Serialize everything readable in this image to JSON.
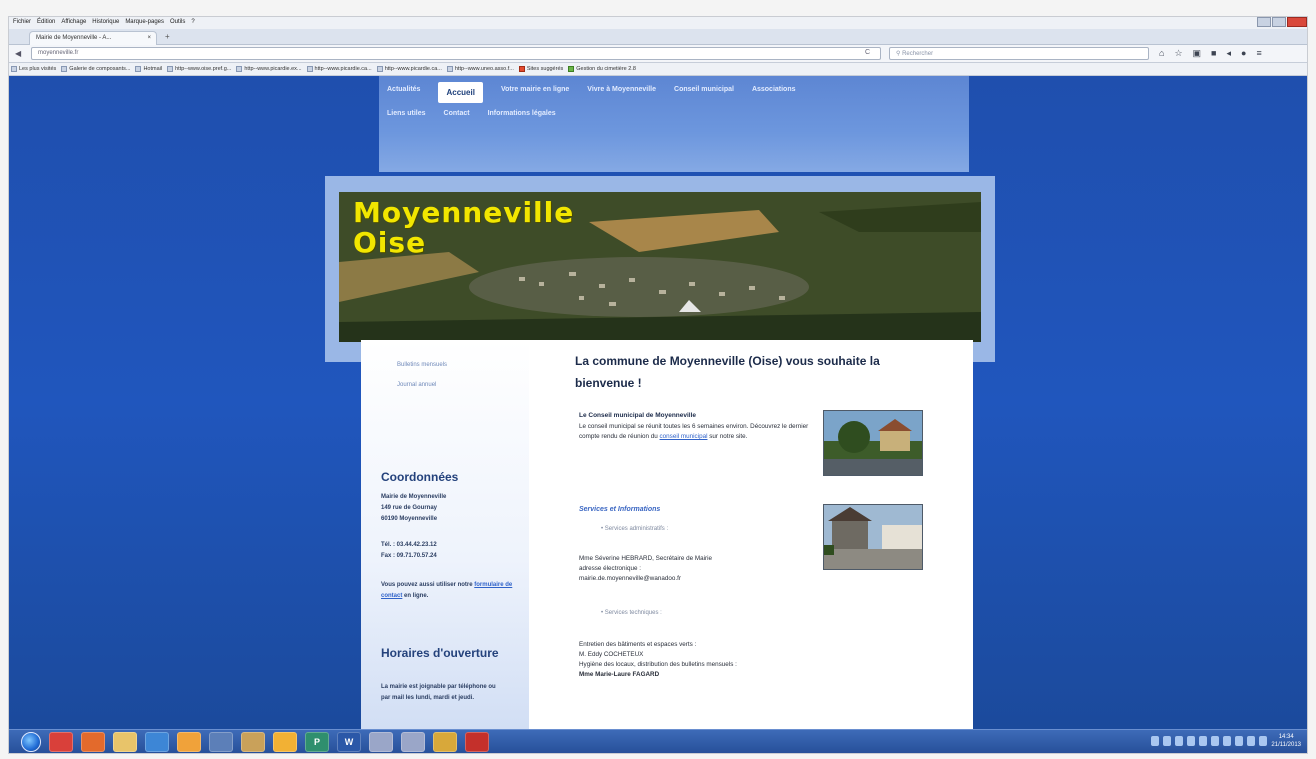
{
  "browser": {
    "menu": [
      "Fichier",
      "Édition",
      "Affichage",
      "Historique",
      "Marque-pages",
      "Outils",
      "?"
    ],
    "tab_title": "Mairie de Moyenneville - A...",
    "tab_close": "×",
    "new_tab": "+",
    "url": "moyenneville.fr",
    "search_placeholder": "Rechercher",
    "bookmarks": [
      {
        "label": "Les plus visités",
        "icon": "page"
      },
      {
        "label": "Galerie de composants...",
        "icon": "page"
      },
      {
        "label": "Hotmail",
        "icon": "page"
      },
      {
        "label": "http--www.oise.pref.g...",
        "icon": "page"
      },
      {
        "label": "http--www.picardie.ex...",
        "icon": "page"
      },
      {
        "label": "http--www.picardie.ca...",
        "icon": "page"
      },
      {
        "label": "http--www.picardie.ca...",
        "icon": "page"
      },
      {
        "label": "http--www.uneo.asso.f...",
        "icon": "page"
      },
      {
        "label": "Sites suggérés",
        "icon": "red"
      },
      {
        "label": "Gestion du cimetière 2.8",
        "icon": "green"
      }
    ]
  },
  "site": {
    "nav_row1": [
      "Actualités",
      "Accueil",
      "Votre mairie en ligne",
      "Vivre à Moyenneville",
      "Conseil municipal",
      "Associations"
    ],
    "nav_active": "Accueil",
    "nav_row2": [
      "Liens utiles",
      "Contact",
      "Informations légales"
    ],
    "banner_title_1": "Moyenneville",
    "banner_title_2": "Oise",
    "sidebar": {
      "links": [
        "Bulletins mensuels",
        "Journal annuel"
      ],
      "coord_heading": "Coordonnées",
      "address": [
        "Mairie de Moyenneville",
        "149 rue de Gournay",
        "60190 Moyenneville"
      ],
      "tel": "Tél. : 03.44.42.23.12",
      "fax": "Fax : 09.71.70.57.24",
      "form_pre": "Vous pouvez aussi utiliser notre",
      "form_link": "formulaire de contact",
      "form_post": "en ligne.",
      "hours_heading": "Horaires d'ouverture",
      "hours_text": "La mairie est joignable par téléphone ou par mail les lundi, mardi et jeudi."
    },
    "main": {
      "welcome": "La commune de Moyenneville (Oise) vous souhaite la bienvenue !",
      "council_title": "Le Conseil municipal de Moyenneville",
      "council_text_1": "Le conseil municipal se réunit toutes les 6 semaines environ. Découvrez le dernier compte rendu de réunion du",
      "council_link": "conseil municipal",
      "council_text_2": "sur notre site.",
      "services_title": "Services et Informations",
      "services_admin": "Services administratifs :",
      "secretary": "Mme Séverine HEBRARD, Secrétaire de Mairie",
      "email_label": "adresse électronique :",
      "email": "mairie.de.moyenneville@wanadoo.fr",
      "services_tech": "Services techniques :",
      "maint_label": "Entretien des bâtiments et espaces verts :",
      "maint_person": "M. Eddy COCHETEUX",
      "hygiene_label": "Hygiène des locaux, distribution des bulletins mensuels :",
      "hygiene_person": "Mme Marie-Laure FAGARD"
    }
  },
  "taskbar": {
    "clock_time": "14:34",
    "clock_date": "21/11/2013",
    "apps": [
      "chrome-icon",
      "firefox-icon",
      "folder-icon",
      "ie-icon",
      "media-icon",
      "calc-icon",
      "paint-icon",
      "pdf-icon",
      "publisher-icon",
      "word-icon",
      "disc-icon",
      "disc-icon",
      "app-icon",
      "acrobat-icon"
    ],
    "app_letters": [
      "",
      "",
      "",
      "",
      "",
      "",
      "",
      "",
      "",
      "P",
      "W",
      "",
      "",
      ""
    ]
  }
}
